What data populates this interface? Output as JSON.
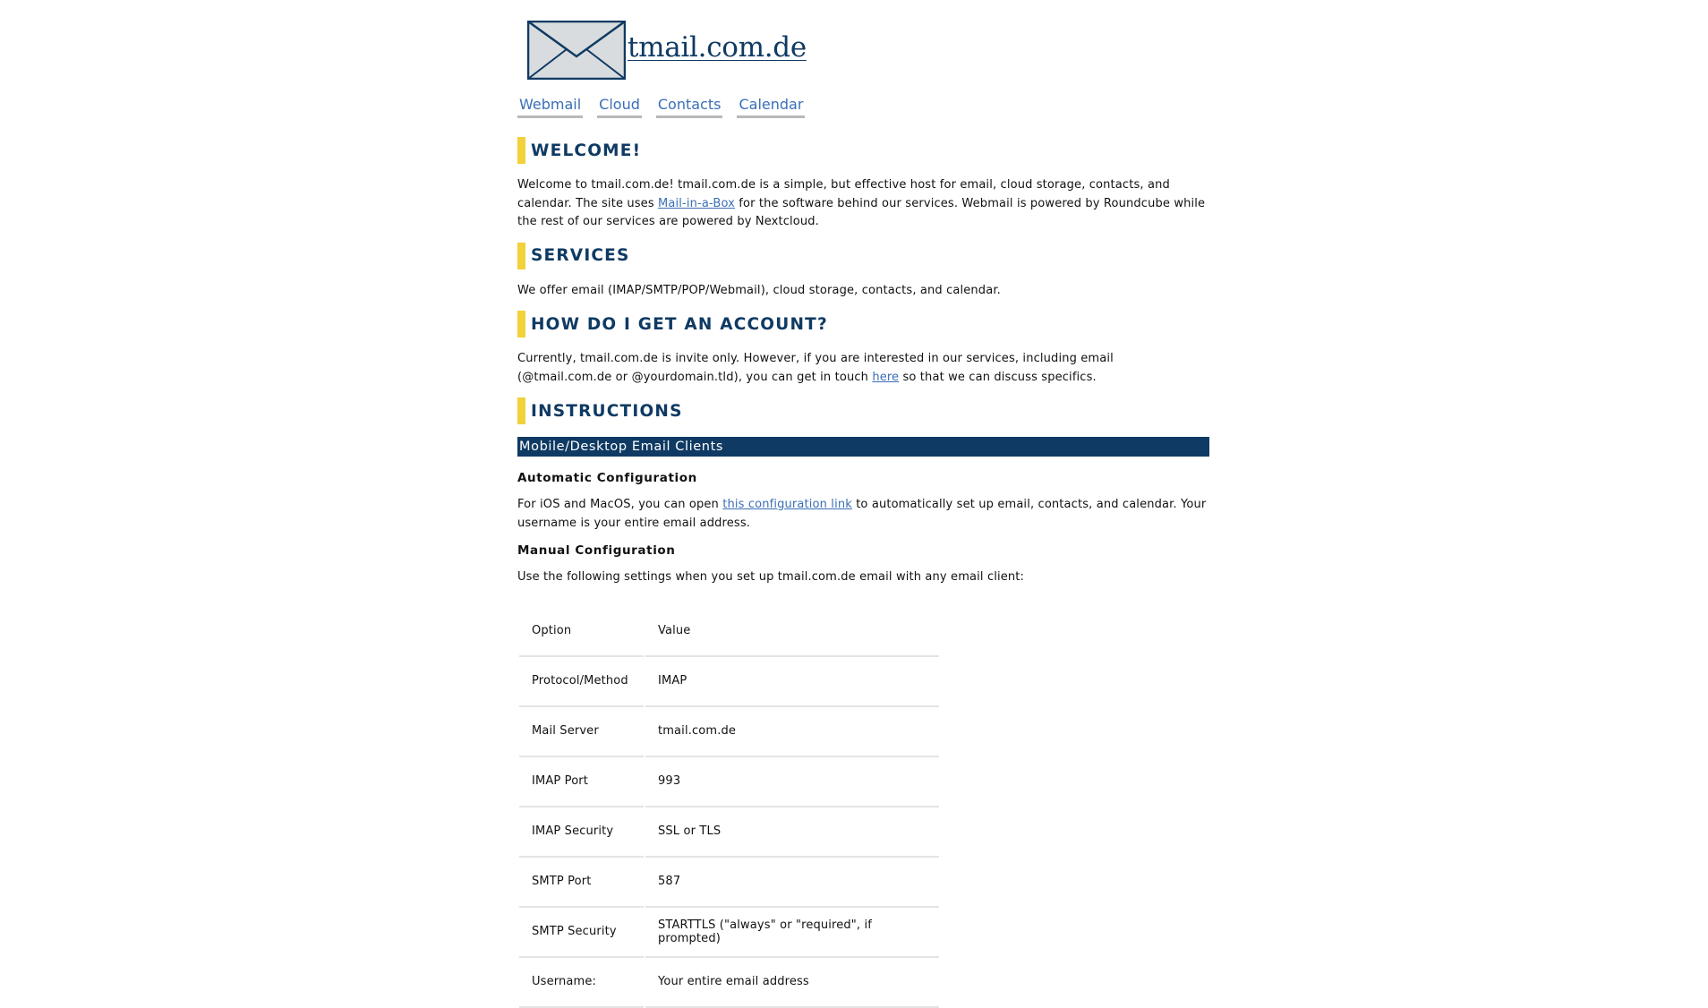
{
  "site": {
    "title": "tmail.com.de",
    "logo_icon": "envelope-icon"
  },
  "nav": {
    "items": [
      {
        "label": "Webmail"
      },
      {
        "label": "Cloud"
      },
      {
        "label": "Contacts"
      },
      {
        "label": "Calendar"
      }
    ]
  },
  "colors": {
    "heading": "#0f3a63",
    "accent_bar": "#f2d13b",
    "link": "#3a6fb6",
    "subsection_bg": "#0f3a63"
  },
  "welcome": {
    "heading": "WELCOME!",
    "text_1": "Welcome to tmail.com.de! tmail.com.de is a simple, but effective host for email, cloud storage, contacts, and calendar. The site uses ",
    "link": "Mail-in-a-Box",
    "text_2": " for the software behind our services. Webmail is powered by Roundcube while the rest of our services are powered by Nextcloud."
  },
  "services": {
    "heading": "SERVICES",
    "text": "We offer email (IMAP/SMTP/POP/Webmail), cloud storage, contacts, and calendar."
  },
  "account": {
    "heading": "HOW DO I GET AN ACCOUNT?",
    "text_1": "Currently, tmail.com.de is invite only. However, if you are interested in our services, including email (@tmail.com.de or @yourdomain.tld), you can get in touch ",
    "link": "here",
    "text_2": " so that we can discuss specifics."
  },
  "instructions": {
    "heading": "INSTRUCTIONS",
    "subsection": "Mobile/Desktop Email Clients",
    "auto": {
      "heading": "Automatic Configuration",
      "text_1": "For iOS and MacOS, you can open ",
      "link": "this configuration link",
      "text_2": " to automatically set up email, contacts, and calendar. Your username is your entire email address."
    },
    "manual": {
      "heading": "Manual Configuration",
      "text": "Use the following settings when you set up tmail.com.de email with any email client:"
    },
    "table": {
      "header": {
        "option": "Option",
        "value": "Value"
      },
      "rows": [
        {
          "option": "Protocol/Method",
          "value": "IMAP"
        },
        {
          "option": "Mail Server",
          "value": "tmail.com.de"
        },
        {
          "option": "IMAP Port",
          "value": "993"
        },
        {
          "option": "IMAP Security",
          "value": "SSL or TLS"
        },
        {
          "option": "SMTP Port",
          "value": "587"
        },
        {
          "option": "SMTP Security",
          "value": "STARTTLS (\"always\" or \"required\", if prompted)"
        },
        {
          "option": "Username:",
          "value": "Your entire email address"
        }
      ]
    }
  }
}
